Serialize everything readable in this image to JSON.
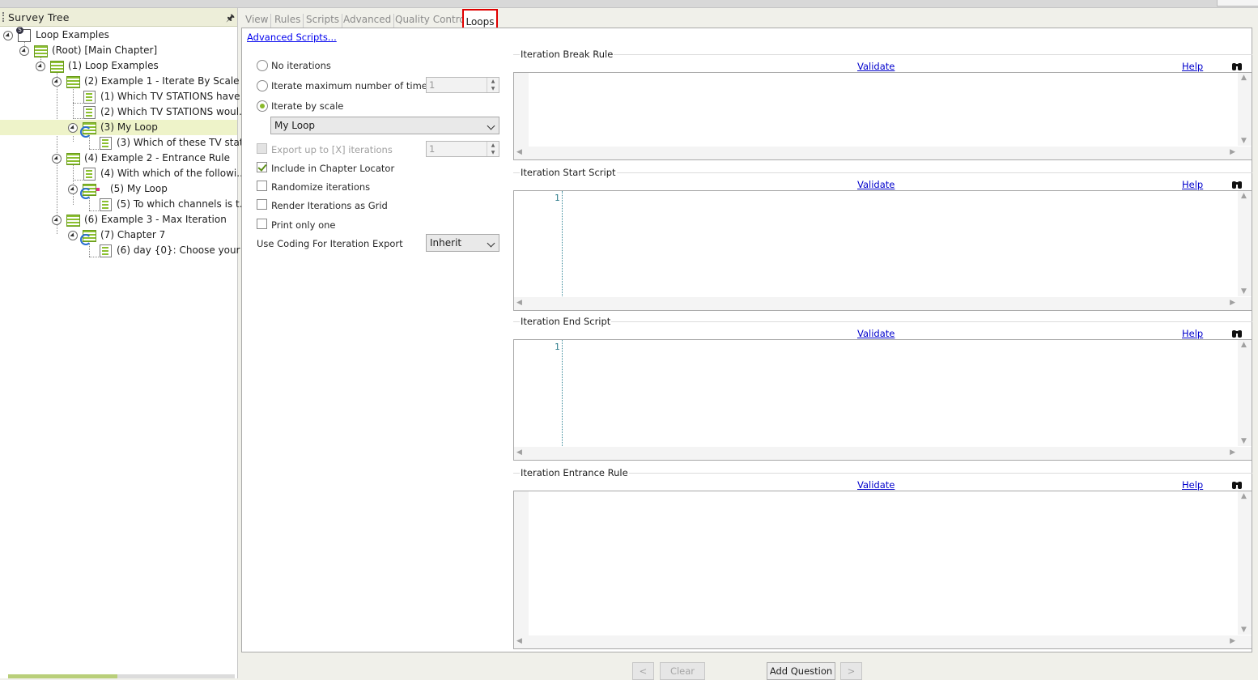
{
  "left_panel": {
    "title": "Survey Tree",
    "tree": [
      {
        "label": "Loop Examples"
      },
      {
        "label": "(Root) [Main Chapter]"
      },
      {
        "label": "(1) Loop Examples"
      },
      {
        "label": "(2) Example 1 - Iterate By Scale"
      },
      {
        "label": "(1) Which TV STATIONS have ..."
      },
      {
        "label": "(2) Which TV STATIONS woul..."
      },
      {
        "label": "(3) My Loop",
        "selected": true
      },
      {
        "label": "(3) Which of these TV stat..."
      },
      {
        "label": "(4) Example 2 - Entrance Rule"
      },
      {
        "label": "(4) With which of the followi..."
      },
      {
        "label": "(5) My Loop"
      },
      {
        "label": "(5) To which channels is t..."
      },
      {
        "label": "(6) Example 3 - Max Iteration"
      },
      {
        "label": "(7) Chapter 7"
      },
      {
        "label": "(6) day {0}: Choose your ..."
      }
    ]
  },
  "tabs": {
    "view": "View",
    "rules": "Rules",
    "scripts": "Scripts",
    "advanced": "Advanced",
    "quality_control": "Quality Control",
    "loops": "Loops",
    "active": "Loops"
  },
  "loops": {
    "advanced_scripts_link": "Advanced Scripts...",
    "no_iterations": "No iterations",
    "iterate_max": "Iterate maximum number of times",
    "iterate_max_value": "1",
    "iterate_by_scale": "Iterate by scale",
    "selected_option": "iterate_by_scale",
    "scale_value": "My Loop",
    "export_up_to": "Export up to [X] iterations",
    "export_up_to_value": "1",
    "include_chapter_locator": "Include in Chapter Locator",
    "include_chapter_locator_checked": true,
    "randomize": "Randomize iterations",
    "render_grid": "Render Iterations as Grid",
    "print_only_one": "Print only one",
    "use_coding_label": "Use Coding For Iteration Export",
    "use_coding_value": "Inherit"
  },
  "scripts": {
    "validate_label": "Validate",
    "help_label": "Help",
    "binoculars_icon": "binoculars-icon",
    "break_rule": {
      "title": "Iteration Break Rule"
    },
    "start_script": {
      "title": "Iteration Start Script",
      "line": "1"
    },
    "end_script": {
      "title": "Iteration End Script",
      "line": "1"
    },
    "entrance_rule": {
      "title": "Iteration Entrance Rule"
    }
  },
  "bottom_bar": {
    "prev": "<",
    "clear": "Clear",
    "add_question": "Add Question",
    "next": ">"
  },
  "colors": {
    "accent_green": "#8ab92a",
    "selection_bg": "#eef3c9",
    "tab_highlight": "#e00000",
    "link": "#0000cc"
  }
}
